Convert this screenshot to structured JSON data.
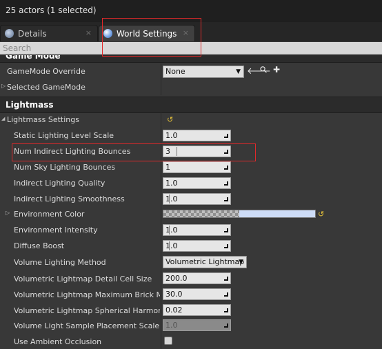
{
  "status": {
    "text": "25 actors (1 selected)"
  },
  "tabs": [
    {
      "label": "Details",
      "close": "×"
    },
    {
      "label": "World Settings",
      "close": "×"
    }
  ],
  "search": {
    "placeholder": "Search"
  },
  "game_mode": {
    "category_label": "Game Mode",
    "override_label": "GameMode Override",
    "override_value": "None",
    "selected_label": "Selected GameMode"
  },
  "lightmass": {
    "category_label": "Lightmass",
    "settings_label": "Lightmass Settings",
    "rows": [
      {
        "label": "Static Lighting Level Scale",
        "value": "1.0"
      },
      {
        "label": "Num Indirect Lighting Bounces",
        "value": "3"
      },
      {
        "label": "Num Sky Lighting Bounces",
        "value": "1"
      },
      {
        "label": "Indirect Lighting Quality",
        "value": "1.0"
      },
      {
        "label": "Indirect Lighting Smoothness",
        "value": "1.0"
      },
      {
        "label": "Environment Color",
        "value": ""
      },
      {
        "label": "Environment Intensity",
        "value": "1.0"
      },
      {
        "label": "Diffuse Boost",
        "value": "1.0"
      },
      {
        "label": "Volume Lighting Method",
        "value": "Volumetric Lightmap"
      },
      {
        "label": "Volumetric Lightmap Detail Cell Size",
        "value": "200.0"
      },
      {
        "label": "Volumetric Lightmap Maximum Brick Memo",
        "value": "30.0"
      },
      {
        "label": "Volumetric Lightmap Spherical Harmonic Sm",
        "value": "0.02"
      },
      {
        "label": "Volume Light Sample Placement Scale",
        "value": "1.0"
      },
      {
        "label": "Use Ambient Occlusion",
        "value": ""
      }
    ]
  },
  "icons": {
    "arrow_left": "🡐",
    "magnify": "⚲",
    "plus": "✚",
    "reset": "↺",
    "expander": "▷",
    "expanded": "◢",
    "dropdown": "▼"
  },
  "colors": {
    "annotation": "#e0292a",
    "environment_color": "#cddcf7"
  }
}
